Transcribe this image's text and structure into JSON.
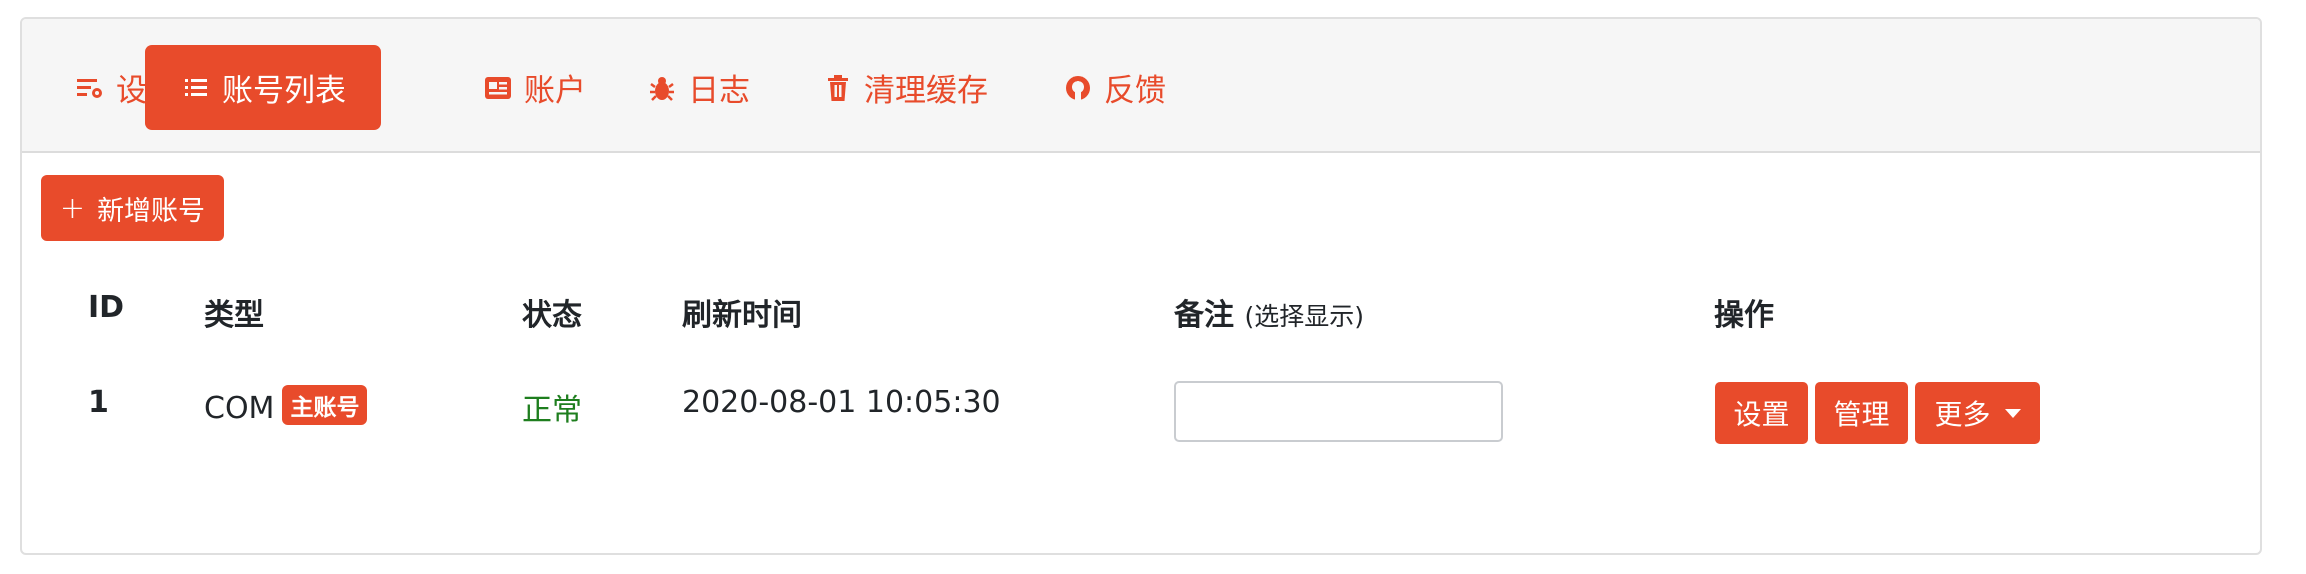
{
  "nav": {
    "items": [
      {
        "label": "设置",
        "icon": "sliders-gear-icon"
      },
      {
        "label": "账号列表",
        "icon": "list-icon",
        "active": true
      },
      {
        "label": "账户",
        "icon": "id-card-icon"
      },
      {
        "label": "日志",
        "icon": "bug-icon"
      },
      {
        "label": "清理缓存",
        "icon": "trash-icon"
      },
      {
        "label": "反馈",
        "icon": "github-icon"
      }
    ]
  },
  "toolbar": {
    "add_label": "新增账号",
    "add_icon": "plus-icon"
  },
  "table": {
    "headers": {
      "id": "ID",
      "type": "类型",
      "status": "状态",
      "refresh": "刷新时间",
      "note": "备注",
      "note_hint": "(选择显示)",
      "ops": "操作"
    },
    "rows": [
      {
        "id": "1",
        "type": "COM",
        "badge": "主账号",
        "status": "正常",
        "refresh": "2020-08-01 10:05:30",
        "note": "",
        "ops": {
          "settings": "设置",
          "manage": "管理",
          "more": "更多"
        }
      }
    ]
  },
  "colors": {
    "accent": "#e84b2b",
    "status_ok": "#1e7e1e",
    "header_bg": "#f6f6f6"
  }
}
